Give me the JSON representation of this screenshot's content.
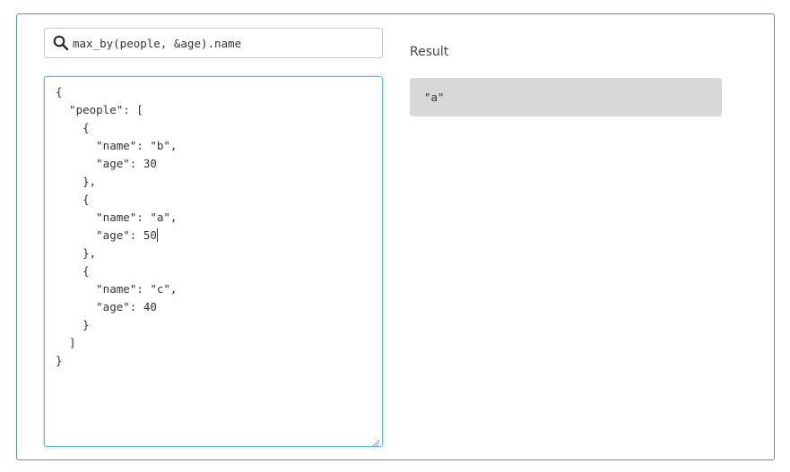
{
  "query": {
    "value": "max_by(people, &age).name",
    "icon": "search-icon"
  },
  "editor": {
    "lines": [
      "{",
      "  \"people\": [",
      "    {",
      "      \"name\": \"b\",",
      "      \"age\": 30",
      "    },",
      "    {",
      "      \"name\": \"a\",",
      "      \"age\": 50",
      "    },",
      "    {",
      "      \"name\": \"c\",",
      "      \"age\": 40",
      "    }",
      "  ]",
      "}"
    ]
  },
  "result": {
    "label": "Result",
    "value": "\"a\""
  },
  "colors": {
    "panel_border": "#5b8fc7",
    "editor_focus_border": "#66afe9",
    "result_background": "#d8d8d8"
  }
}
